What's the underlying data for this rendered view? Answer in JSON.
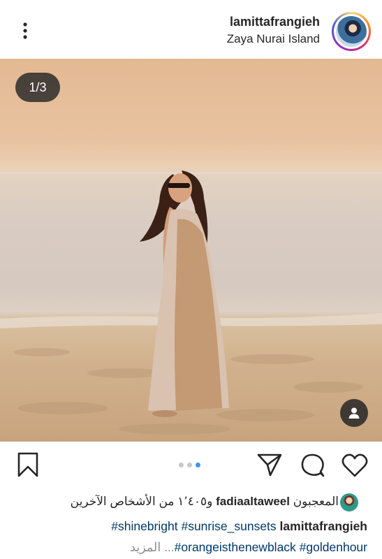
{
  "post": {
    "username": "lamittafrangieh",
    "location": "Zaya Nurai Island",
    "avatar_icon": "profile-avatar",
    "menu_icon": "more-vertical-icon"
  },
  "carousel": {
    "counter": "1/3",
    "current_slide": 1,
    "total_slides": 3,
    "active_dot_color": "#3897f0",
    "inactive_dot_color": "#c7c7c7"
  },
  "actions": {
    "save_icon": "bookmark-icon",
    "share_icon": "send-icon",
    "comment_icon": "comment-icon",
    "like_icon": "heart-icon",
    "tag_icon": "user-tag-icon"
  },
  "likes": {
    "prefix": "المعجبون",
    "user": "fadiaaltaweel",
    "suffix": "و١٬٤٠٥ من الأشخاص الآخرين"
  },
  "caption": {
    "user": "lamittafrangieh",
    "line1_tags": [
      "#shinebright",
      "#sunrise_sunsets"
    ],
    "line2_tags": [
      "#orangeisthenewblack",
      "#goldenhour"
    ],
    "ellipsis": "...",
    "more": "المزيد"
  }
}
